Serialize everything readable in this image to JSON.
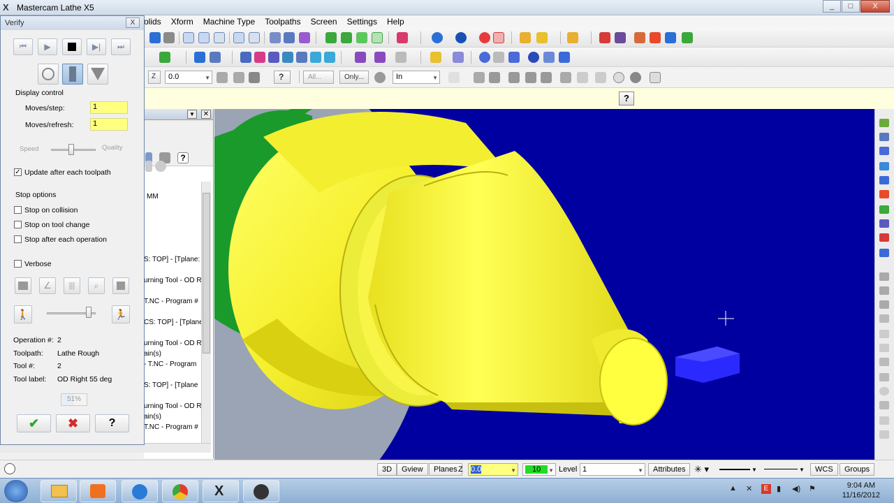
{
  "window": {
    "title": "Mastercam Lathe X5",
    "minimize": "_",
    "maximize": "□",
    "close": "X"
  },
  "menu": [
    "olids",
    "Xform",
    "Machine Type",
    "Toolpaths",
    "Screen",
    "Settings",
    "Help"
  ],
  "toolbar3": {
    "z_label": "Z",
    "z_value": "0.0",
    "all_btn": "All...",
    "only_btn": "Only...",
    "units_value": "In",
    "help": "?"
  },
  "prompt_help": "?",
  "ops_panel": {
    "tree_lines": [
      "MM",
      "S: TOP] - [Tplane:",
      "urning Tool - OD R",
      "T.NC - Program #",
      "CS: TOP] - [Tplane",
      "urning Tool - OD R",
      "ain(s)",
      "- T.NC - Program",
      "S: TOP] - [Tplane",
      "urning Tool - OD R",
      "ain(s)",
      "T.NC - Program #"
    ]
  },
  "verify": {
    "title": "Verify",
    "close": "X",
    "display_control_label": "Display control",
    "moves_step_label": "Moves/step:",
    "moves_step_value": "1",
    "moves_refresh_label": "Moves/refresh:",
    "moves_refresh_value": "1",
    "speed_label": "Speed",
    "quality_label": "Quality",
    "speed_quality_level": 0.45,
    "update_after_toolpath_label": "Update after each toolpath",
    "update_after_toolpath_checked": true,
    "stop_options_label": "Stop options",
    "stop_on_collision_label": "Stop on collision",
    "stop_on_tool_change_label": "Stop on tool change",
    "stop_after_operation_label": "Stop after each operation",
    "verbose_label": "Verbose",
    "sim_speed_level": 0.9,
    "operation_label": "Operation #:",
    "operation_value": "2",
    "toolpath_label": "Toolpath:",
    "toolpath_value": "Lathe Rough",
    "tool_label": "Tool #:",
    "tool_value": "2",
    "tool_name_label": "Tool label:",
    "tool_name_value": "OD Right 55 deg",
    "progress_text": "51%",
    "progress": 0.51,
    "ok_icon": "✔",
    "cancel_icon": "✖",
    "help_icon": "?"
  },
  "statusbar": {
    "mode_3d": "3D",
    "gview": "Gview",
    "planes": "Planes",
    "z_label": "Z",
    "z_value": "0.0",
    "color_value": "10",
    "level_label": "Level",
    "level_value": "1",
    "attributes": "Attributes",
    "wcs": "WCS",
    "groups": "Groups"
  },
  "taskbar": {
    "time": "9:04 AM",
    "date": "11/16/2012"
  },
  "colors": {
    "viewport_bg": "#0000a0",
    "part_yellow": "#ffff33",
    "chuck_green": "#1a9a2a",
    "stock_blue": "#2a2aff",
    "input_yellow": "#ffff80"
  }
}
